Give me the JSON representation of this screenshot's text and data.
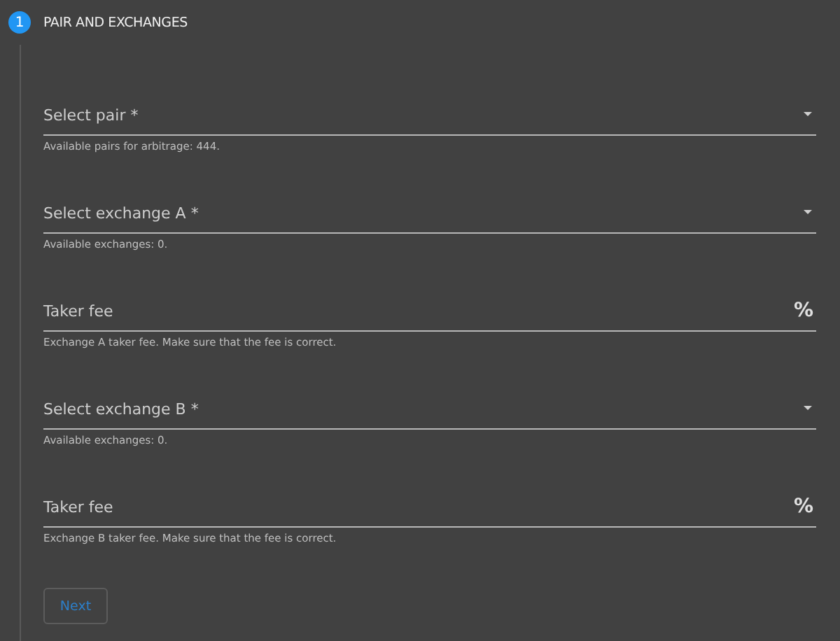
{
  "step": {
    "number": "1",
    "title": "PAIR AND EXCHANGES"
  },
  "fields": [
    {
      "kind": "select",
      "label": "Select pair *",
      "hint": "Available pairs for arbitrage: 444."
    },
    {
      "kind": "select",
      "label": "Select exchange A *",
      "hint": "Available exchanges: 0."
    },
    {
      "kind": "fee",
      "label": "Taker fee",
      "suffix": "%",
      "hint": "Exchange A taker fee. Make sure that the fee is correct."
    },
    {
      "kind": "select",
      "label": "Select exchange B *",
      "hint": "Available exchanges: 0."
    },
    {
      "kind": "fee",
      "label": "Taker fee",
      "suffix": "%",
      "hint": "Exchange B taker fee. Make sure that the fee is correct."
    }
  ],
  "button": {
    "label": "Next"
  }
}
